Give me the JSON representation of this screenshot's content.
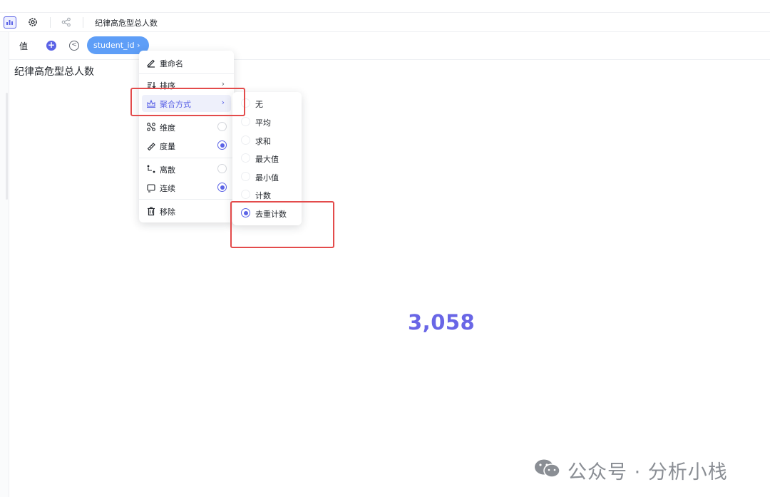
{
  "toolbar": {
    "title": "纪律高危型总人数"
  },
  "fieldrow": {
    "value_label": "值",
    "add_glyph": "+",
    "back_glyph": "<",
    "field_pill": "student_id ›"
  },
  "chart": {
    "title": "纪律高危型总人数",
    "kpi_value": "3,058",
    "accent_color": "#6966e6"
  },
  "context_menu": {
    "items": [
      {
        "label": "重命名",
        "icon": "pencil-icon"
      },
      {
        "label": "排序",
        "icon": "sort-icon",
        "arrow": "›"
      },
      {
        "label": "聚合方式",
        "icon": "aggregate-icon",
        "arrow": "›",
        "highlighted": true
      },
      {
        "label": "维度",
        "icon": "dimension-icon",
        "selected": false
      },
      {
        "label": "度量",
        "icon": "ruler-icon",
        "selected": true
      },
      {
        "label": "离散",
        "icon": "discrete-icon",
        "selected": false
      },
      {
        "label": "连续",
        "icon": "continuous-icon",
        "selected": true
      },
      {
        "label": "移除",
        "icon": "trash-icon"
      }
    ]
  },
  "aggregation_menu": {
    "options": [
      {
        "label": "无",
        "selected": false
      },
      {
        "label": "平均",
        "selected": false
      },
      {
        "label": "求和",
        "selected": false
      },
      {
        "label": "最大值",
        "selected": false
      },
      {
        "label": "最小值",
        "selected": false
      },
      {
        "label": "计数",
        "selected": false
      },
      {
        "label": "去重计数",
        "selected": true
      }
    ]
  },
  "watermark": {
    "text": "公众号 · 分析小栈",
    "icon": "wechat-icon"
  },
  "colors": {
    "brand": "#5b63e6",
    "pill": "#5e9ef7",
    "annotation": "#e34b4b"
  }
}
